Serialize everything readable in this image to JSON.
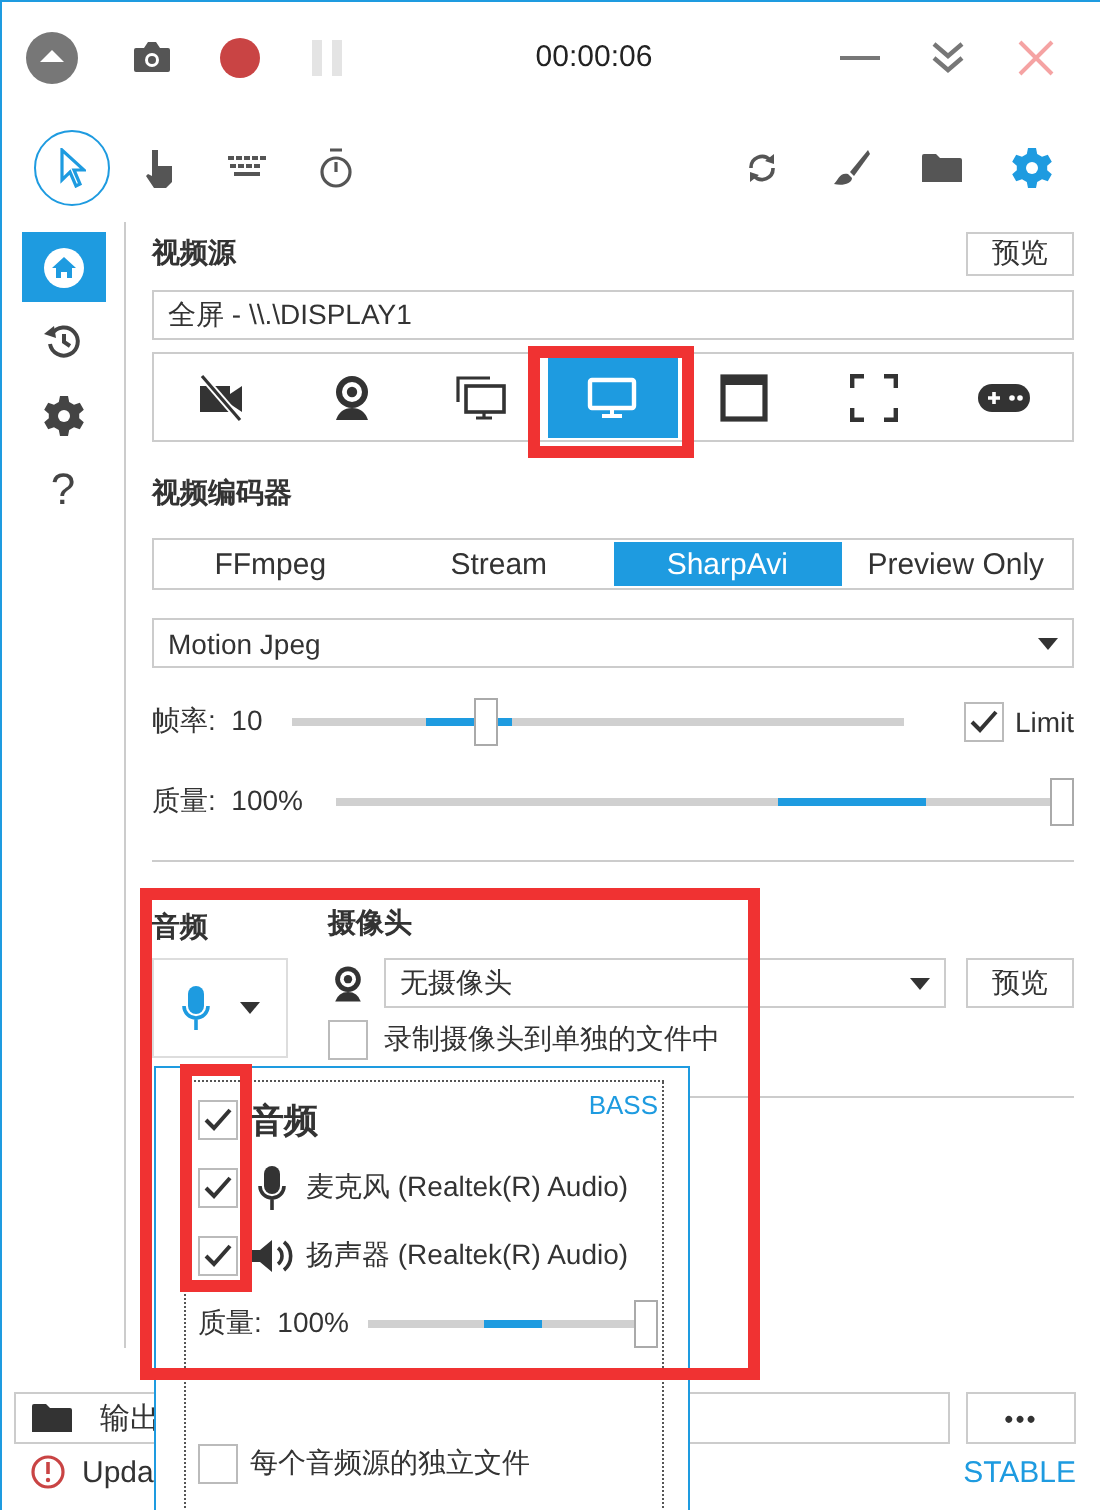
{
  "title_bar": {
    "timer": "00:00:06",
    "recording": true,
    "paused": false
  },
  "toolbar": {
    "tools": [
      {
        "kind": "cursor",
        "selected": true
      },
      {
        "kind": "click",
        "selected": false
      },
      {
        "kind": "keys",
        "selected": false
      },
      {
        "kind": "timer",
        "selected": false
      }
    ]
  },
  "sidebar": {
    "items": [
      {
        "kind": "home",
        "selected": true
      },
      {
        "kind": "history",
        "selected": false
      },
      {
        "kind": "settings",
        "selected": false
      },
      {
        "kind": "help",
        "label": "?",
        "selected": false
      }
    ]
  },
  "video_source": {
    "heading": "视频源",
    "preview_button": "预览",
    "source": "全屏 - \\\\.\\DISPLAY1",
    "sources": [
      {
        "kind": "no-video",
        "selected": false
      },
      {
        "kind": "webcam",
        "selected": false
      },
      {
        "kind": "screens",
        "selected": false
      },
      {
        "kind": "screen",
        "selected": true
      },
      {
        "kind": "window",
        "selected": false
      },
      {
        "kind": "region",
        "selected": false
      },
      {
        "kind": "game",
        "selected": false
      }
    ]
  },
  "video_encoder": {
    "heading": "视频编码器",
    "tabs": [
      {
        "label": "FFmpeg",
        "selected": false
      },
      {
        "label": "Stream",
        "selected": false
      },
      {
        "label": "SharpAvi",
        "selected": true
      },
      {
        "label": "Preview Only",
        "selected": false
      }
    ],
    "codec": "Motion Jpeg",
    "frame_rate": {
      "label": "帧率:  10",
      "level": 0.31,
      "limit": {
        "label": "Limit",
        "checked": true
      }
    },
    "quality": {
      "label": "质量:  100%",
      "level": 1
    }
  },
  "audio": {
    "heading": "音频"
  },
  "webcam": {
    "heading": "摄像头",
    "device": "无摄像头",
    "preview_button": "预览",
    "separate_file": {
      "label": "录制摄像头到单独的文件中",
      "checked": false
    }
  },
  "audio_popup": {
    "title": "音频",
    "checked": true,
    "backend": "BASS",
    "devices": [
      {
        "kind": "microphone",
        "name": "麦克风 (Realtek(R) Audio)",
        "checked": true
      },
      {
        "kind": "speaker",
        "name": "扬声器 (Realtek(R) Audio)",
        "checked": true
      }
    ],
    "quality": {
      "label": "质量:  100%",
      "level": 1
    },
    "separate_files": {
      "label": "每个音频源的独立文件",
      "checked": false
    }
  },
  "output": {
    "label": "输出",
    "more_button": "•••"
  },
  "status_bar": {
    "message": "Upda",
    "channel": "STABLE"
  }
}
